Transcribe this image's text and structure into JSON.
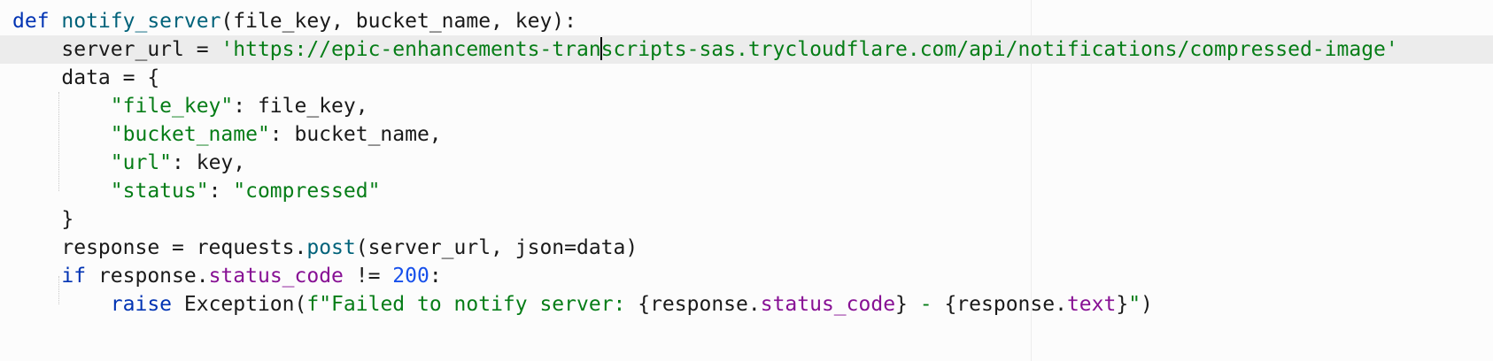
{
  "editor": {
    "language": "python",
    "lines": [
      {
        "indent": "",
        "tokens": [
          {
            "t": "kw",
            "v": "def"
          },
          {
            "t": "op",
            "v": " "
          },
          {
            "t": "fn",
            "v": "notify_server"
          },
          {
            "t": "op",
            "v": "(file_key, bucket_name, key):"
          }
        ]
      },
      {
        "indent": "    ",
        "current": true,
        "tokens": [
          {
            "t": "op",
            "v": "server_url = "
          },
          {
            "t": "str",
            "v": "'https://epic-enhancements-tran"
          },
          {
            "t": "caret",
            "v": ""
          },
          {
            "t": "str",
            "v": "scripts-sas.trycloudflare.com/api/notifications/compressed-image'"
          }
        ]
      },
      {
        "indent": "    ",
        "tokens": [
          {
            "t": "op",
            "v": "data = {"
          }
        ]
      },
      {
        "indent": "        ",
        "tokens": [
          {
            "t": "str",
            "v": "\"file_key\""
          },
          {
            "t": "op",
            "v": ": file_key,"
          }
        ]
      },
      {
        "indent": "        ",
        "tokens": [
          {
            "t": "str",
            "v": "\"bucket_name\""
          },
          {
            "t": "op",
            "v": ": bucket_name,"
          }
        ]
      },
      {
        "indent": "        ",
        "tokens": [
          {
            "t": "str",
            "v": "\"url\""
          },
          {
            "t": "op",
            "v": ": key,"
          }
        ]
      },
      {
        "indent": "        ",
        "tokens": [
          {
            "t": "str",
            "v": "\"status\""
          },
          {
            "t": "op",
            "v": ": "
          },
          {
            "t": "str",
            "v": "\"compressed\""
          }
        ]
      },
      {
        "indent": "    ",
        "tokens": [
          {
            "t": "op",
            "v": "}"
          }
        ]
      },
      {
        "indent": "    ",
        "tokens": [
          {
            "t": "op",
            "v": "response = requests."
          },
          {
            "t": "fn",
            "v": "post"
          },
          {
            "t": "op",
            "v": "(server_url, json=data)"
          }
        ]
      },
      {
        "indent": "    ",
        "tokens": [
          {
            "t": "kw",
            "v": "if"
          },
          {
            "t": "op",
            "v": " response."
          },
          {
            "t": "attr",
            "v": "status_code"
          },
          {
            "t": "op",
            "v": " != "
          },
          {
            "t": "num",
            "v": "200"
          },
          {
            "t": "op",
            "v": ":"
          }
        ]
      },
      {
        "indent": "        ",
        "tokens": [
          {
            "t": "kw",
            "v": "raise"
          },
          {
            "t": "op",
            "v": " Exception("
          },
          {
            "t": "str",
            "v": "f\"Failed to notify server: "
          },
          {
            "t": "op",
            "v": "{response."
          },
          {
            "t": "attr",
            "v": "status_code"
          },
          {
            "t": "op",
            "v": "}"
          },
          {
            "t": "str",
            "v": " - "
          },
          {
            "t": "op",
            "v": "{response."
          },
          {
            "t": "attr",
            "v": "text"
          },
          {
            "t": "op",
            "v": "}"
          },
          {
            "t": "str",
            "v": "\""
          },
          {
            "t": "op",
            "v": ")"
          }
        ]
      }
    ]
  }
}
